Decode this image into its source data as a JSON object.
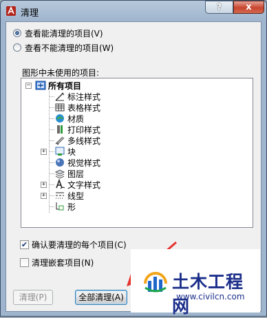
{
  "window": {
    "title": "清理",
    "help_glyph": "?",
    "close_glyph": "x"
  },
  "radios": [
    {
      "label": "查看能清理的项目(V)",
      "selected": true
    },
    {
      "label": "查看不能清理的项目(W)",
      "selected": false
    }
  ],
  "tree": {
    "group_label": "图形中未使用的项目:",
    "root": {
      "label": "所有项目",
      "expander": "−"
    },
    "items": [
      {
        "label": "标注样式",
        "icon": "dimension-style-icon",
        "expander": ""
      },
      {
        "label": "表格样式",
        "icon": "table-style-icon",
        "expander": ""
      },
      {
        "label": "材质",
        "icon": "material-icon",
        "expander": ""
      },
      {
        "label": "打印样式",
        "icon": "plot-style-icon",
        "expander": ""
      },
      {
        "label": "多线样式",
        "icon": "multiline-style-icon",
        "expander": ""
      },
      {
        "label": "块",
        "icon": "block-icon",
        "expander": "+"
      },
      {
        "label": "视觉样式",
        "icon": "visual-style-icon",
        "expander": ""
      },
      {
        "label": "图层",
        "icon": "layer-icon",
        "expander": ""
      },
      {
        "label": "文字样式",
        "icon": "text-style-icon",
        "expander": "+"
      },
      {
        "label": "线型",
        "icon": "linetype-icon",
        "expander": "+"
      },
      {
        "label": "形",
        "icon": "shape-icon",
        "expander": ""
      }
    ]
  },
  "checkboxes": [
    {
      "label": "确认要清理的每个项目(C)",
      "checked": true
    },
    {
      "label": "清理嵌套项目(N)",
      "checked": false
    }
  ],
  "buttons": {
    "purge": "清理(P)",
    "purge_all": "全部清理(A)"
  },
  "watermark": {
    "name": "土木工程网",
    "url": "www.civilcn.com"
  },
  "colors": {
    "accent": "#1a2d8a",
    "arrow": "#e5322d"
  }
}
